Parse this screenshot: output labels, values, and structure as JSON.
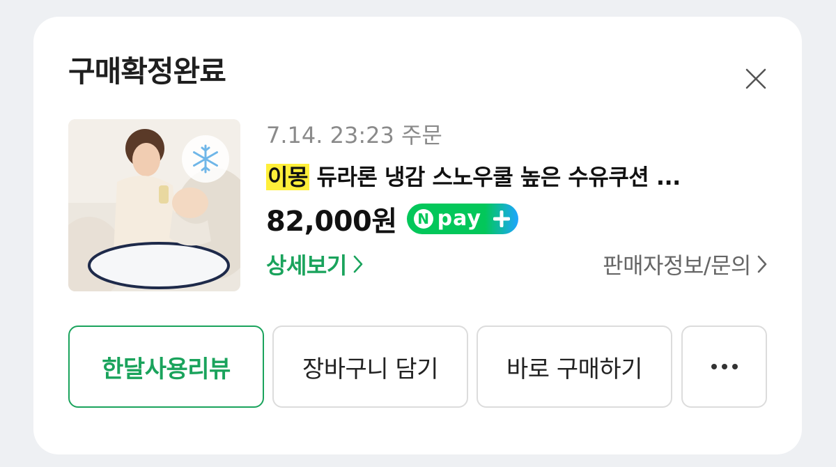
{
  "header": {
    "title": "구매확정완료",
    "close_icon": "close-icon"
  },
  "product": {
    "image_alt": "수유쿠션을 사용하는 엄마와 아기",
    "badge_icon": "snowflake-icon",
    "order_date": "7.14. 23:23 주문",
    "brand": "이몽",
    "name": "듀라론 냉감 스노우쿨 높은 수유쿠션 ...",
    "price": "82,000원",
    "npay_label": "pay",
    "npay_n": "N"
  },
  "links": {
    "detail": "상세보기",
    "seller": "판매자정보/문의"
  },
  "actions": {
    "review": "한달사용리뷰",
    "cart": "장바구니 담기",
    "buy": "바로 구매하기",
    "more_icon": "more-dots-icon"
  },
  "colors": {
    "accent_green": "#1aa35c",
    "brand_highlight": "#ffef3a",
    "npay_green": "#03c75a"
  }
}
